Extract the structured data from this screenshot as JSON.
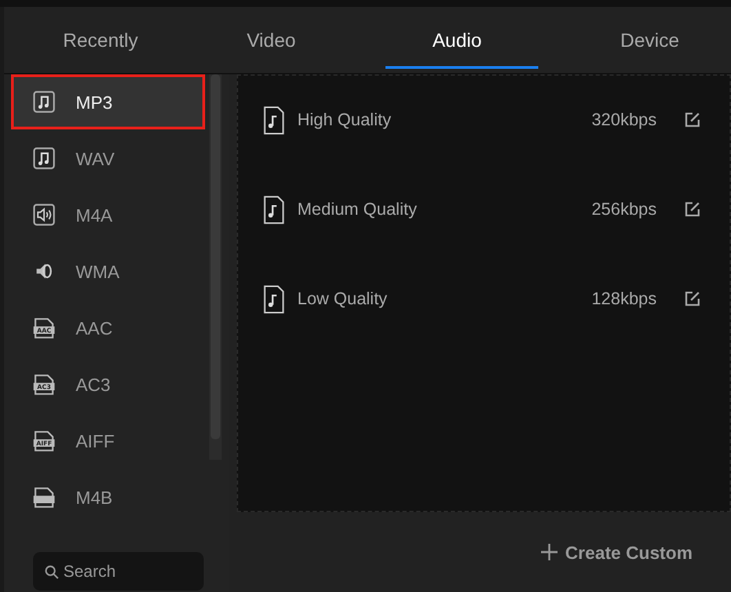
{
  "tabs": [
    {
      "label": "Recently",
      "selected": false
    },
    {
      "label": "Video",
      "selected": false
    },
    {
      "label": "Audio",
      "selected": true
    },
    {
      "label": "Device",
      "selected": false
    }
  ],
  "formats": [
    {
      "label": "MP3",
      "kind": "note",
      "selected": true
    },
    {
      "label": "WAV",
      "kind": "note",
      "selected": false
    },
    {
      "label": "M4A",
      "kind": "speaker",
      "selected": false
    },
    {
      "label": "WMA",
      "kind": "horn",
      "selected": false
    },
    {
      "label": "AAC",
      "kind": "file",
      "badge": "AAC",
      "selected": false
    },
    {
      "label": "AC3",
      "kind": "file",
      "badge": "AC3",
      "selected": false
    },
    {
      "label": "AIFF",
      "kind": "file",
      "badge": "AIFF",
      "selected": false
    },
    {
      "label": "M4B",
      "kind": "file",
      "selected": false
    }
  ],
  "search": {
    "placeholder": "Search"
  },
  "presets": [
    {
      "name": "High Quality",
      "bitrate": "320kbps"
    },
    {
      "name": "Medium Quality",
      "bitrate": "256kbps"
    },
    {
      "name": "Low Quality",
      "bitrate": "128kbps"
    }
  ],
  "create_button": "Create Custom"
}
